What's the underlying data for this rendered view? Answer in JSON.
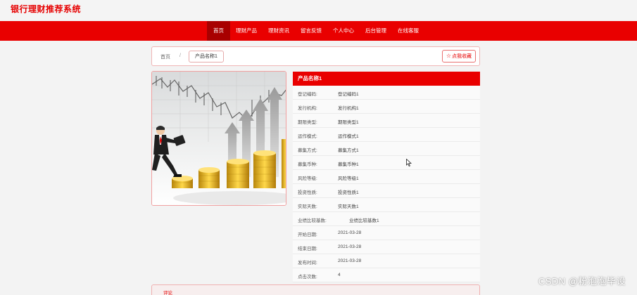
{
  "site": {
    "title": "银行理财推荐系统"
  },
  "nav": {
    "items": [
      "首页",
      "理财产品",
      "理财资讯",
      "留言反馈",
      "个人中心",
      "后台管理",
      "在线客服"
    ],
    "active_index": 0
  },
  "breadcrumb": {
    "home": "首页",
    "separator": "/",
    "current": "产品名称1"
  },
  "favorite_button": {
    "icon": "star-outline-icon",
    "label": "点我收藏"
  },
  "product": {
    "name": "产品名称1",
    "fields": [
      {
        "key": "登记编码:",
        "value": "登记编码1"
      },
      {
        "key": "发行机构:",
        "value": "发行机构1"
      },
      {
        "key": "期限类型:",
        "value": "期限类型1"
      },
      {
        "key": "运作模式:",
        "value": "运作模式1"
      },
      {
        "key": "募集方式:",
        "value": "募集方式1"
      },
      {
        "key": "募集币种:",
        "value": "募集币种1"
      },
      {
        "key": "风险等级:",
        "value": "风险等级1"
      },
      {
        "key": "投资性质:",
        "value": "投资性质1"
      },
      {
        "key": "实际天数:",
        "value": "实际天数1"
      },
      {
        "key": "业绩比较基数:",
        "value": "业绩比较基数1"
      },
      {
        "key": "开始日期:",
        "value": "2021-03-28"
      },
      {
        "key": "结束日期:",
        "value": "2021-03-28"
      },
      {
        "key": "发布时间:",
        "value": "2021-03-28"
      },
      {
        "key": "点击次数:",
        "value": "4"
      }
    ]
  },
  "comments": {
    "title": "评论"
  },
  "watermark": "CSDN @粉泡泡毕设",
  "colors": {
    "brand_red": "#e90000",
    "active_nav": "#a80000"
  }
}
